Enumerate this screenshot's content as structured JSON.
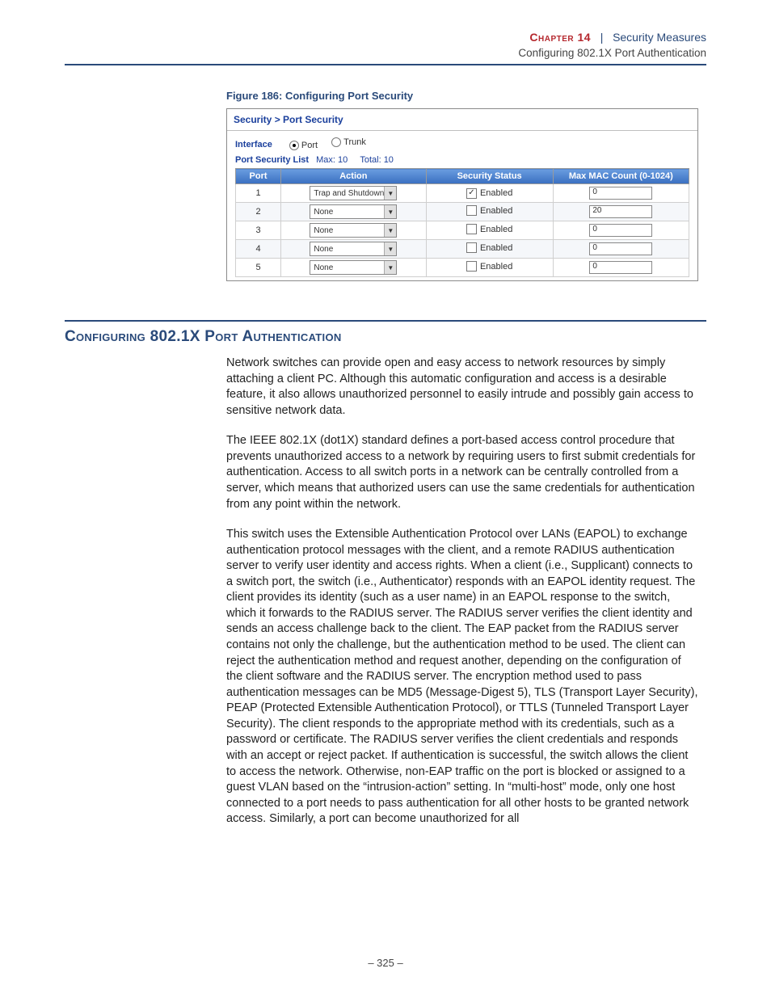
{
  "header": {
    "chapter_label": "Chapter 14",
    "chapter_title": "Security Measures",
    "subtitle": "Configuring 802.1X Port Authentication"
  },
  "figure": {
    "caption": "Figure 186:  Configuring Port Security",
    "breadcrumb": "Security > Port Security",
    "interface_label": "Interface",
    "radios": {
      "port": "Port",
      "trunk": "Trunk"
    },
    "list_label": "Port Security List",
    "max_label": "Max: 10",
    "total_label": "Total: 10",
    "columns": {
      "port": "Port",
      "action": "Action",
      "status": "Security Status",
      "maxmac": "Max MAC Count (0-1024)"
    },
    "rows": [
      {
        "port": "1",
        "action": "Trap and Shutdown",
        "enabled": true,
        "status_label": "Enabled",
        "maxmac": "0"
      },
      {
        "port": "2",
        "action": "None",
        "enabled": false,
        "status_label": "Enabled",
        "maxmac": "20"
      },
      {
        "port": "3",
        "action": "None",
        "enabled": false,
        "status_label": "Enabled",
        "maxmac": "0"
      },
      {
        "port": "4",
        "action": "None",
        "enabled": false,
        "status_label": "Enabled",
        "maxmac": "0"
      },
      {
        "port": "5",
        "action": "None",
        "enabled": false,
        "status_label": "Enabled",
        "maxmac": "0"
      }
    ]
  },
  "section": {
    "heading": "Configuring 802.1X Port Authentication",
    "para1": "Network switches can provide open and easy access to network resources by simply attaching a client PC. Although this automatic configuration and access is a desirable feature, it also allows unauthorized personnel to easily intrude and possibly gain access to sensitive network data.",
    "para2": "The IEEE 802.1X (dot1X) standard defines a port-based access control procedure that prevents unauthorized access to a network by requiring users to first submit credentials for authentication. Access to all switch ports in a network can be centrally controlled from a server, which means that authorized users can use the same credentials for authentication from any point within the network.",
    "para3": "This switch uses the Extensible Authentication Protocol over LANs (EAPOL) to exchange authentication protocol messages with the client, and a remote RADIUS authentication server to verify user identity and access rights. When a client (i.e., Supplicant) connects to a switch port, the switch (i.e., Authenticator) responds with an EAPOL identity request. The client provides its identity (such as a user name) in an EAPOL response to the switch, which it forwards to the RADIUS server. The RADIUS server verifies the client identity and sends an access challenge back to the client. The EAP packet from the RADIUS server contains not only the challenge, but the authentication method to be used. The client can reject the authentication method and request another, depending on the configuration of the client software and the RADIUS server. The encryption method used to pass authentication messages can be MD5 (Message-Digest 5), TLS (Transport Layer Security), PEAP (Protected Extensible Authentication Protocol), or TTLS (Tunneled Transport Layer Security). The client responds to the appropriate method with its credentials, such as a password or certificate. The RADIUS server verifies the client credentials and responds with an accept or reject packet. If authentication is successful, the switch allows the client to access the network. Otherwise, non-EAP traffic on the port is blocked or assigned to a guest VLAN based on the “intrusion-action” setting. In “multi-host” mode, only one host connected to a port needs to pass authentication for all other hosts to be granted network access. Similarly, a port can become unauthorized for all"
  },
  "page_number": "–  325  –"
}
